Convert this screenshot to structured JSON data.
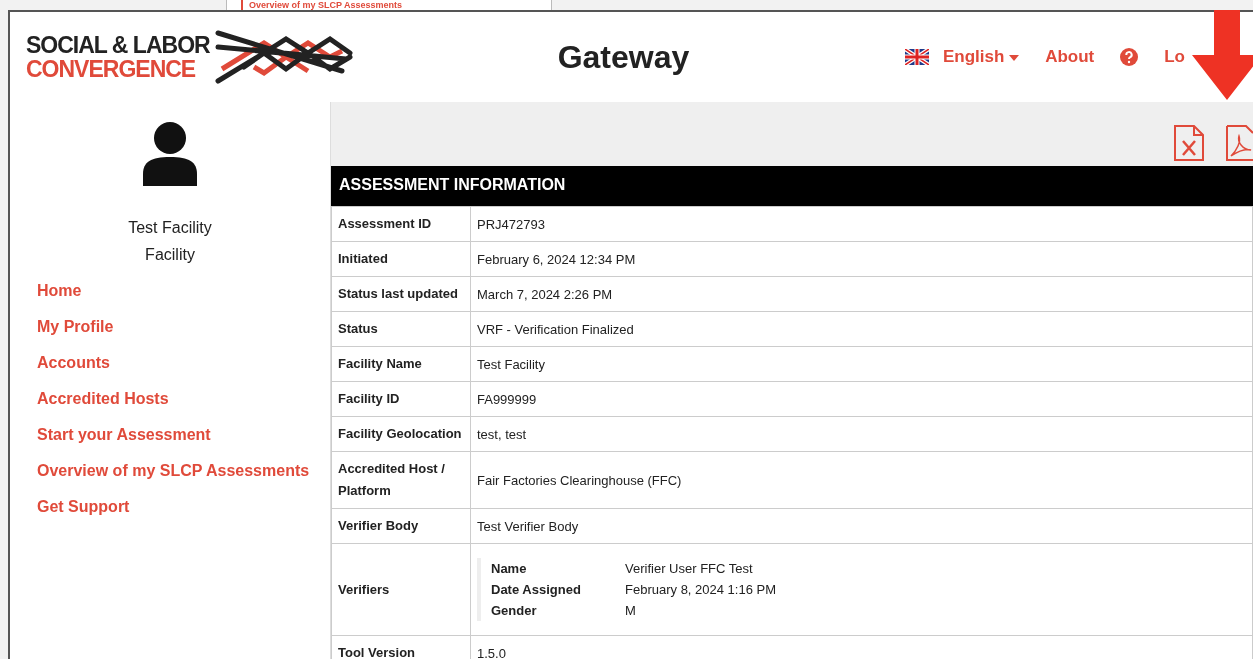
{
  "background_window": {
    "link": "Overview of my SLCP Assessments"
  },
  "header": {
    "logo": {
      "line1": "SOCIAL & LABOR",
      "line2": "CONVERGENCE"
    },
    "title": "Gateway",
    "language": "English",
    "nav": [
      "About",
      "Lo"
    ]
  },
  "sidebar": {
    "user": {
      "name": "Test Facility",
      "role": "Facility"
    },
    "items": [
      {
        "label": "Home",
        "selected": false
      },
      {
        "label": "My Profile",
        "selected": false
      },
      {
        "label": "Accounts",
        "selected": false
      },
      {
        "label": "Accredited Hosts",
        "selected": false
      },
      {
        "label": "Start your Assessment",
        "selected": false
      },
      {
        "label": "Overview of my SLCP Assessments",
        "selected": false
      },
      {
        "label": "Get Support",
        "selected": false
      }
    ]
  },
  "table": {
    "title": "ASSESSMENT INFORMATION",
    "rows": [
      {
        "label": "Assessment ID",
        "value": "PRJ472793"
      },
      {
        "label": "Initiated",
        "value": "February 6, 2024 12:34 PM"
      },
      {
        "label": "Status last updated",
        "value": "March 7, 2024 2:26 PM"
      },
      {
        "label": "Status",
        "value": "VRF - Verification Finalized"
      },
      {
        "label": "Facility Name",
        "value": "Test Facility"
      },
      {
        "label": "Facility ID",
        "value": "FA999999"
      },
      {
        "label": "Facility Geolocation",
        "value": "test, test"
      },
      {
        "label": "Accredited Host / Platform",
        "value": "Fair Factories Clearinghouse (FFC)"
      },
      {
        "label": "Verifier Body",
        "value": "Test Verifier Body"
      },
      {
        "label": "Verifiers",
        "details": [
          {
            "key": "Name",
            "value": "Verifier User FFC Test"
          },
          {
            "key": "Date Assigned",
            "value": "February 8, 2024 1:16 PM"
          },
          {
            "key": "Gender",
            "value": "M"
          }
        ]
      },
      {
        "label": "Tool Version",
        "value": "1.5.0"
      }
    ]
  }
}
